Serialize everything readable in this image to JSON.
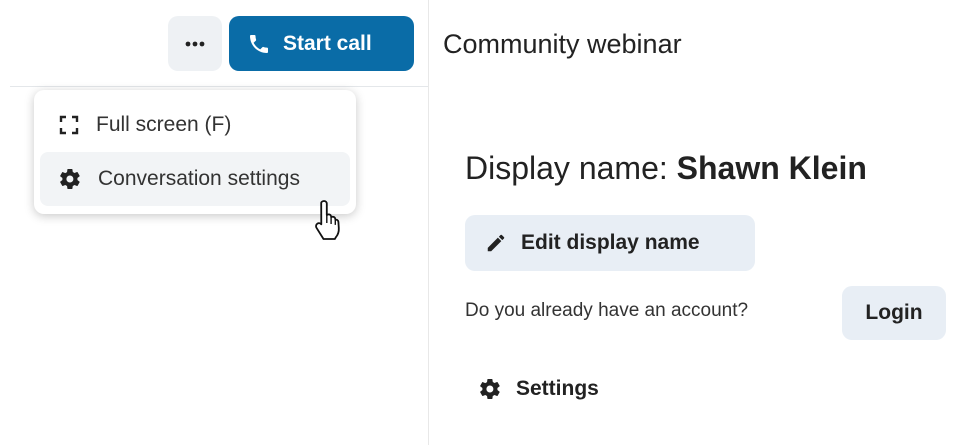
{
  "header": {
    "more_icon": "more-horizontal-icon",
    "start_call_label": "Start call",
    "start_call_icon": "phone-icon",
    "conversation_title": "Community webinar"
  },
  "menu": {
    "items": [
      {
        "label": "Full screen (F)",
        "icon": "fullscreen-icon"
      },
      {
        "label": "Conversation settings",
        "icon": "gear-icon",
        "hovered": true
      }
    ]
  },
  "main": {
    "display_name_label": "Display name: ",
    "display_name_value": "Shawn Klein",
    "edit_display_name_label": "Edit display name",
    "account_prompt": "Do you already have an account?",
    "login_label": "Login",
    "settings_label": "Settings"
  },
  "colors": {
    "primary": "#0a6ca7",
    "secondary_button_bg": "#e8eef5",
    "hover_bg": "#f2f4f6"
  }
}
